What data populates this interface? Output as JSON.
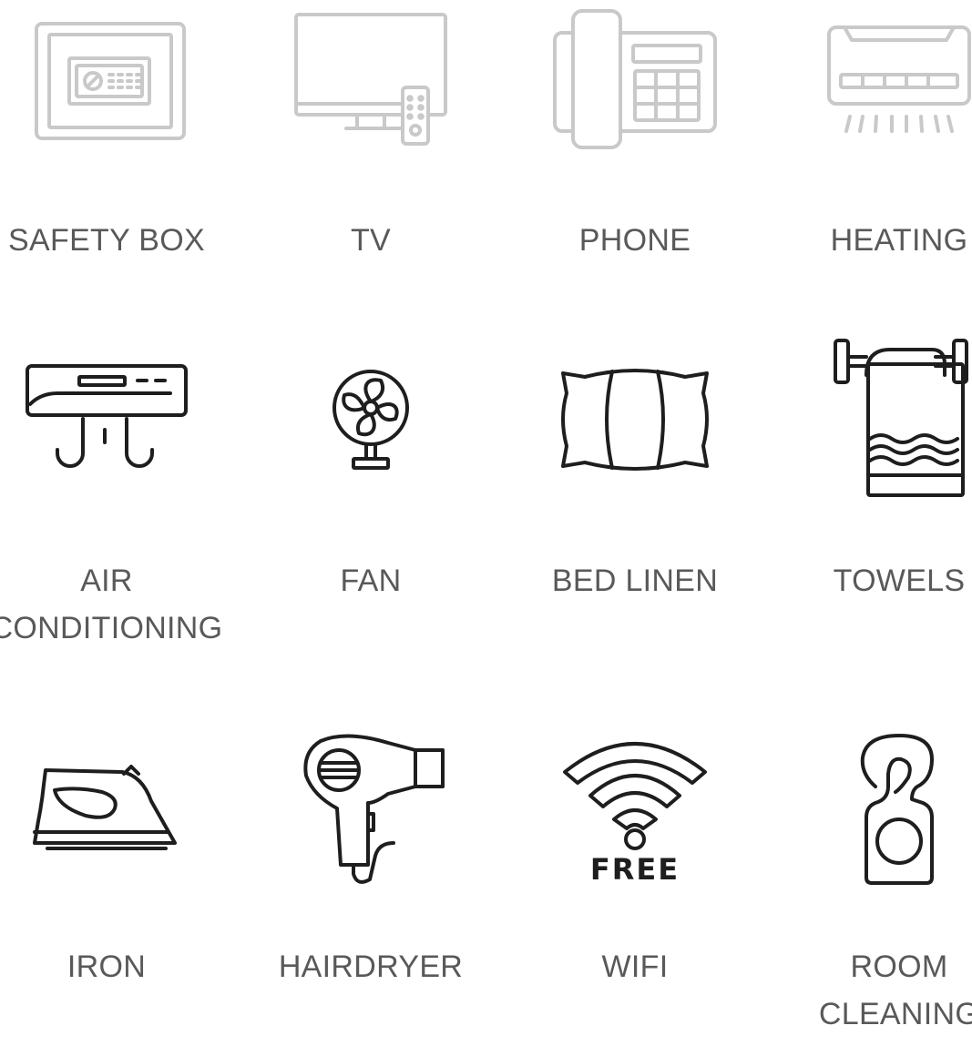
{
  "amenities": {
    "rows": [
      {
        "items": [
          {
            "label": "SAFETY BOX",
            "icon": "safety-box-icon",
            "style": "light"
          },
          {
            "label": "TV",
            "icon": "tv-icon",
            "style": "light"
          },
          {
            "label": "PHONE",
            "icon": "phone-icon",
            "style": "light"
          },
          {
            "label": "HEATING",
            "icon": "heating-icon",
            "style": "light"
          }
        ]
      },
      {
        "items": [
          {
            "label": "AIR\nCONDITIONING",
            "icon": "air-conditioning-icon",
            "style": "dark"
          },
          {
            "label": "FAN",
            "icon": "fan-icon",
            "style": "dark"
          },
          {
            "label": "BED LINEN",
            "icon": "pillow-icon",
            "style": "dark"
          },
          {
            "label": "TOWELS",
            "icon": "towel-icon",
            "style": "dark"
          }
        ]
      },
      {
        "items": [
          {
            "label": "IRON",
            "icon": "iron-icon",
            "style": "dark"
          },
          {
            "label": "HAIRDRYER",
            "icon": "hairdryer-icon",
            "style": "dark"
          },
          {
            "label": "WIFI",
            "icon": "wifi-icon",
            "style": "dark",
            "icon_text": "FREE"
          },
          {
            "label": "ROOM\nCLEANING",
            "icon": "door-hanger-icon",
            "style": "dark"
          }
        ]
      }
    ]
  },
  "colors": {
    "label_text": "#595959",
    "icon_light": "#c9c9c9",
    "icon_dark": "#1e1e1e",
    "background": "#ffffff"
  }
}
